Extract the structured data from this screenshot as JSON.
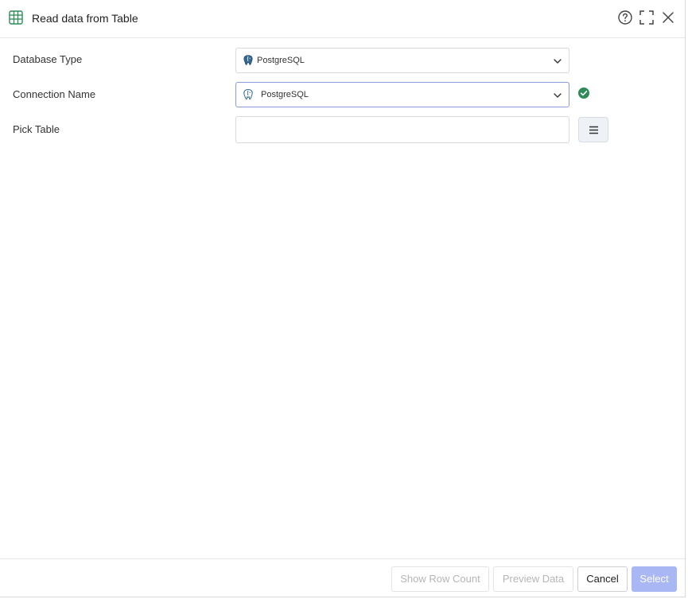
{
  "dialog": {
    "title": "Read data from Table",
    "icons": {
      "title_icon": "table-icon",
      "help": "help-circle-icon",
      "maximize": "maximize-icon",
      "close": "close-icon"
    }
  },
  "form": {
    "database_type": {
      "label": "Database Type",
      "value": "PostgreSQL",
      "icon": "postgresql-elephant-icon"
    },
    "connection_name": {
      "label": "Connection Name",
      "value": "PostgreSQL",
      "icon": "postgresql-elephant-icon",
      "status_icon": "check-circle-icon",
      "status_color": "#2e8b57"
    },
    "pick_table": {
      "label": "Pick Table",
      "value": "",
      "placeholder": "",
      "browse_icon": "list-icon"
    }
  },
  "footer": {
    "show_row_count": "Show Row Count",
    "preview_data": "Preview Data",
    "cancel": "Cancel",
    "select": "Select"
  },
  "colors": {
    "accent_disabled": "#a9b8f4",
    "title_icon": "#2e8b57",
    "success": "#2e8b57"
  }
}
